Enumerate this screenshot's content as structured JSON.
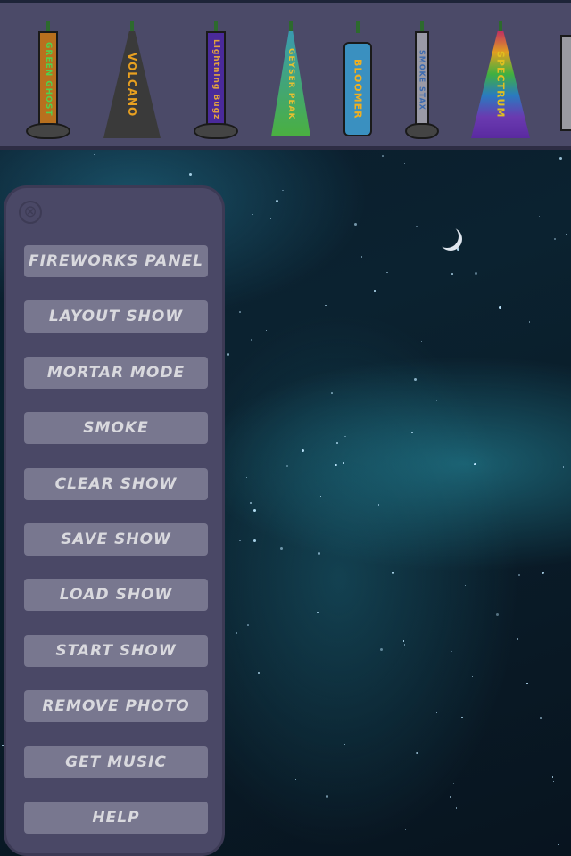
{
  "fireworks": [
    {
      "label": "GREEN GHOST",
      "shape": "tube",
      "color": "#b8701e",
      "text_color": "#4fd24f"
    },
    {
      "label": "VOLCANO",
      "shape": "cone",
      "color": "#3a3a3a",
      "text_color": "#e8a020"
    },
    {
      "label": "Lightning Bugz",
      "shape": "tube",
      "color": "#4a2a9a",
      "text_color": "#e0a040"
    },
    {
      "label": "GEYSER PEAK",
      "shape": "cone",
      "color": "#3a9ab0",
      "text_color": "#e8c030"
    },
    {
      "label": "BLOOMER",
      "shape": "tube",
      "color": "#3a90c0",
      "text_color": "#f0b020"
    },
    {
      "label": "SMOKE STAX",
      "shape": "tube",
      "color": "#9a9aa6",
      "text_color": "#3a6ab0"
    },
    {
      "label": "SPECTRUM",
      "shape": "cone",
      "color": "#6a3ab0",
      "text_color": "#e0c020"
    }
  ],
  "menu": {
    "close_icon": "close-circle-icon",
    "buttons": [
      "FIREWORKS PANEL",
      "LAYOUT SHOW",
      "MORTAR MODE",
      "SMOKE",
      "CLEAR SHOW",
      "SAVE SHOW",
      "LOAD SHOW",
      "START SHOW",
      "REMOVE PHOTO",
      "GET MUSIC",
      "HELP"
    ]
  },
  "colors": {
    "panel": "#4a4866",
    "button": "#78778f",
    "button_text": "#d9d9de",
    "topbar": "#4b4a68"
  }
}
